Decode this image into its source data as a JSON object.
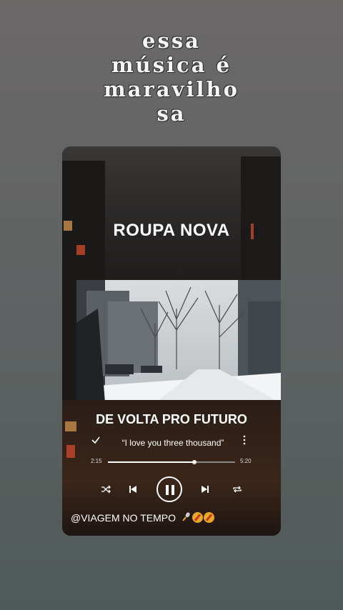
{
  "caption": {
    "lines": [
      "essa",
      "música é",
      "maravilho",
      "sa"
    ]
  },
  "player": {
    "artist": "ROUPA NOVA",
    "song_title": "DE VOLTA PRO FUTURO",
    "lyric": "“I love you three thousand”",
    "current_time": "2:15",
    "total_time": "5:20",
    "progress": 0.68,
    "handle": "@VIAGEM NO TEMPO",
    "icons": {
      "check": "check-icon",
      "more": "more-vertical-icon",
      "shuffle": "shuffle-icon",
      "previous": "skip-previous-icon",
      "pause": "pause-icon",
      "next": "skip-next-icon",
      "repeat": "repeat-icon"
    },
    "emoji": [
      "microphone-emoji",
      "compass-emoji",
      "compass-emoji"
    ]
  },
  "colors": {
    "background_top": "#6b6868",
    "background_bottom": "#4f5a58",
    "card": "#1b1918",
    "text": "#ffffff"
  }
}
